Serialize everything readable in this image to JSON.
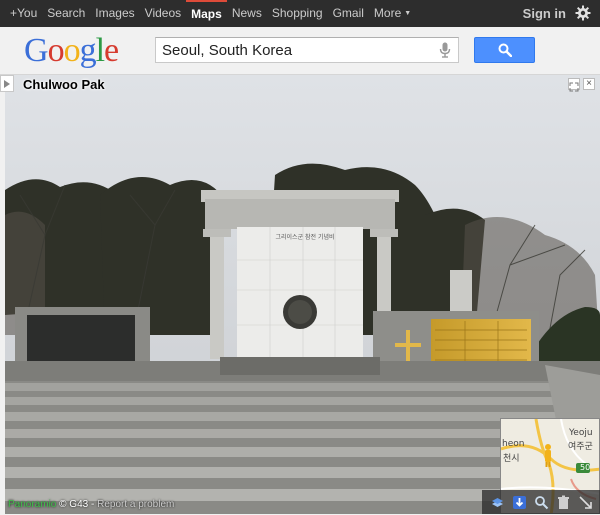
{
  "topbar": {
    "nav": [
      {
        "label": "+You",
        "active": false
      },
      {
        "label": "Search",
        "active": false
      },
      {
        "label": "Images",
        "active": false
      },
      {
        "label": "Videos",
        "active": false
      },
      {
        "label": "Maps",
        "active": true
      },
      {
        "label": "News",
        "active": false
      },
      {
        "label": "Shopping",
        "active": false
      },
      {
        "label": "Gmail",
        "active": false
      },
      {
        "label": "More",
        "active": false
      }
    ],
    "signin_label": "Sign in",
    "settings_icon": "gear-icon"
  },
  "header": {
    "logo_letters": [
      "G",
      "o",
      "o",
      "g",
      "l",
      "e"
    ],
    "search_value": "Seoul, South Korea",
    "mic_icon": "microphone-icon",
    "search_button_icon": "magnifier-icon"
  },
  "streetview": {
    "photographer": "Chulwoo Pak",
    "monument_inscription": "그리이스군 참전 기념비",
    "attribution": {
      "brand": "Panoramio",
      "copyright": "© G43",
      "separator": " - ",
      "report_link": "Report a problem"
    }
  },
  "minimap": {
    "labels": [
      {
        "text": "Yeoju"
      },
      {
        "text": "여주군"
      },
      {
        "text": "heon"
      },
      {
        "text": "천시"
      },
      {
        "text": "50"
      }
    ]
  },
  "colors": {
    "topbar_bg": "#2d2d2d",
    "active_tab_accent": "#dd4b39",
    "search_button": "#4d90fe"
  }
}
